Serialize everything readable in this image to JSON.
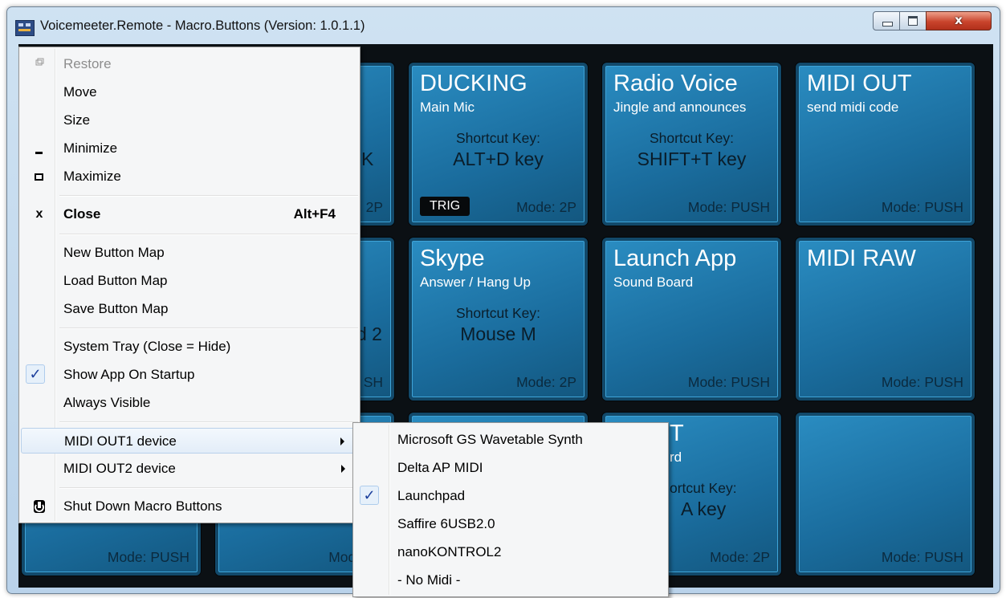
{
  "window": {
    "title": "Voicemeeter.Remote - Macro.Buttons (Version: 1.0.1.1)",
    "close_glyph": "x"
  },
  "tiles": [
    {
      "id": "ducking",
      "title": "DUCKING",
      "subtitle": "Main Mic",
      "shortcut_label": "Shortcut Key:",
      "shortcut_value": "ALT+D key",
      "trig": "TRIG",
      "mode": "Mode: 2P"
    },
    {
      "id": "radio-voice",
      "title": "Radio Voice",
      "subtitle": "Jingle and announces",
      "shortcut_label": "Shortcut Key:",
      "shortcut_value": "SHIFT+T key",
      "mode": "Mode: PUSH"
    },
    {
      "id": "midi-out",
      "title": "MIDI OUT",
      "subtitle": "send midi code",
      "mode": "Mode: PUSH"
    },
    {
      "id": "skype",
      "title": "Skype",
      "subtitle": "Answer / Hang Up",
      "shortcut_label": "Shortcut Key:",
      "shortcut_value": "Mouse M",
      "mode": "Mode: 2P"
    },
    {
      "id": "launch-app",
      "title": "Launch App",
      "subtitle": "Sound Board",
      "mode": "Mode: PUSH"
    },
    {
      "id": "midi-raw",
      "title": "MIDI RAW",
      "mode": "Mode: PUSH"
    },
    {
      "id": "r3c4",
      "mode": "Mode: PUSH"
    },
    {
      "id": "r3c1",
      "mode": "Mode: PUSH"
    }
  ],
  "partial_tiles": {
    "r1c2_fragment": "K",
    "r1c2_mode": "2P",
    "r2c2_fragment": "d 2",
    "r2c2_mode": "SH",
    "r3c2_mode": "Mode: PU",
    "r3c3_title": "T",
    "r3c3_sub": "rd",
    "r3c3_shortcut_label": "ortcut Key:",
    "r3c3_shortcut_value": "A key",
    "r3c3_mode": "Mode: 2P"
  },
  "system_menu": {
    "restore": "Restore",
    "move": "Move",
    "size": "Size",
    "minimize": "Minimize",
    "maximize": "Maximize",
    "close": "Close",
    "close_shortcut": "Alt+F4",
    "new_map": "New Button Map",
    "load_map": "Load Button Map",
    "save_map": "Save Button Map",
    "system_tray": "System Tray (Close = Hide)",
    "show_on_startup": "Show App On Startup",
    "always_visible": "Always Visible",
    "midi_out1": "MIDI OUT1 device",
    "midi_out2": "MIDI OUT2 device",
    "shutdown": "Shut Down Macro Buttons",
    "close_icon_glyph": "x",
    "check_glyph": "✓"
  },
  "midi_submenu": {
    "items": [
      "Microsoft GS Wavetable Synth",
      "Delta AP MIDI",
      "Launchpad",
      "Saffire 6USB2.0",
      "nanoKONTROL2",
      "- No Midi -"
    ],
    "checked_index": 2,
    "check_glyph": "✓"
  }
}
